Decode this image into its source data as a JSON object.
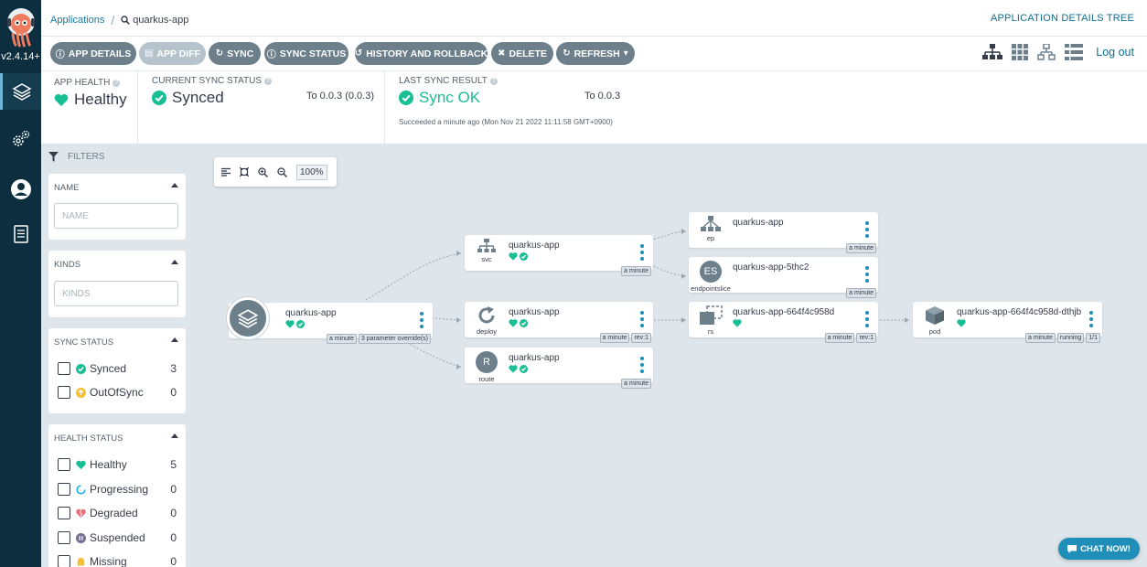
{
  "nav": {
    "version": "v2.4.14+",
    "items": [
      {
        "icon": "layers-icon"
      },
      {
        "icon": "gears-icon"
      },
      {
        "icon": "user-icon"
      },
      {
        "icon": "docs-icon"
      }
    ]
  },
  "breadcrumb": {
    "link": "Applications",
    "current": "quarkus-app"
  },
  "header": {
    "title": "APPLICATION DETAILS TREE",
    "logout": "Log out"
  },
  "toolbar": {
    "app_details": "APP DETAILS",
    "app_diff": "APP DIFF",
    "sync": "SYNC",
    "sync_status": "SYNC STATUS",
    "history": "HISTORY AND ROLLBACK",
    "delete": "DELETE",
    "refresh": "REFRESH"
  },
  "status": {
    "health_label": "APP HEALTH",
    "health_value": "Healthy",
    "sync_label": "CURRENT SYNC STATUS",
    "sync_value": "Synced",
    "sync_rev": "To 0.0.3 (0.0.3)",
    "last_label": "LAST SYNC RESULT",
    "last_value": "Sync OK",
    "last_rev": "To 0.0.3",
    "last_detail": "Succeeded a minute ago (Mon Nov 21 2022 11:11:58 GMT+0900)",
    "colors": {
      "healthy": "#18be94",
      "accent": "#0e6e91"
    }
  },
  "filters": {
    "header": "FILTERS",
    "name": {
      "title": "NAME",
      "placeholder": "NAME"
    },
    "kinds": {
      "title": "KINDS",
      "placeholder": "KINDS"
    },
    "sync_status": {
      "title": "SYNC STATUS",
      "items": [
        {
          "label": "Synced",
          "count": "3"
        },
        {
          "label": "OutOfSync",
          "count": "0"
        }
      ]
    },
    "health_status": {
      "title": "HEALTH STATUS",
      "items": [
        {
          "label": "Healthy",
          "count": "5"
        },
        {
          "label": "Progressing",
          "count": "0"
        },
        {
          "label": "Degraded",
          "count": "0"
        },
        {
          "label": "Suspended",
          "count": "0"
        },
        {
          "label": "Missing",
          "count": "0"
        }
      ]
    }
  },
  "graph": {
    "zoom": "100%",
    "nodes": {
      "app": {
        "name": "quarkus-app",
        "tags": [
          "a minute",
          "3 parameter override(s)"
        ]
      },
      "svc": {
        "name": "quarkus-app",
        "kind": "svc",
        "tags": [
          "a minute"
        ]
      },
      "deploy": {
        "name": "quarkus-app",
        "kind": "deploy",
        "tags": [
          "a minute",
          "rev:1"
        ]
      },
      "route": {
        "name": "quarkus-app",
        "kind": "route",
        "badge": "R",
        "tags": [
          "a minute"
        ]
      },
      "ep": {
        "name": "quarkus-app",
        "kind": "ep",
        "tags": [
          "a minute"
        ]
      },
      "eps": {
        "name": "quarkus-app-5thc2",
        "kind": "endpointslice",
        "badge": "ES",
        "tags": [
          "a minute"
        ]
      },
      "rs": {
        "name": "quarkus-app-664f4c958d",
        "kind": "rs",
        "tags": [
          "a minute",
          "rev:1"
        ]
      },
      "pod": {
        "name": "quarkus-app-664f4c958d-dthjb",
        "kind": "pod",
        "tags": [
          "a minute",
          "running",
          "1/1"
        ]
      }
    }
  },
  "chat": "CHAT NOW!"
}
